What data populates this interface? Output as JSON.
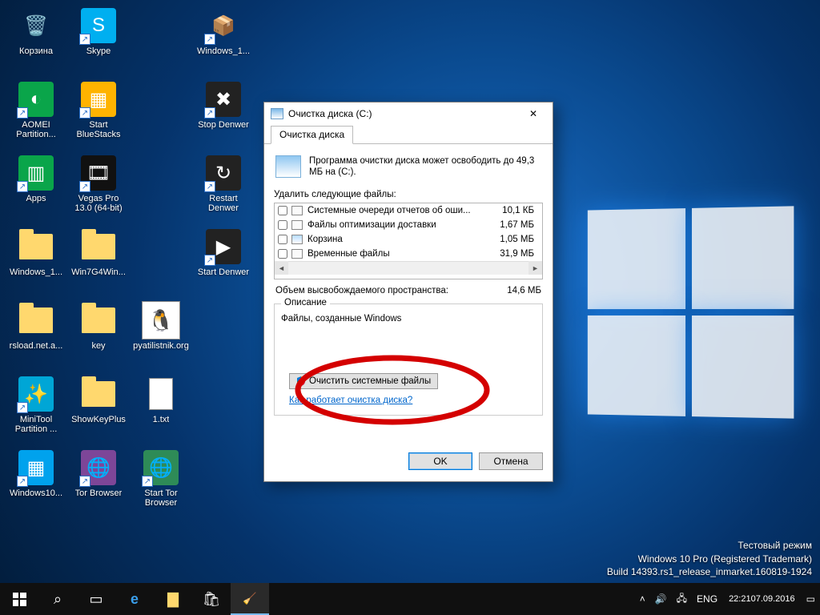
{
  "desktop": {
    "rows": [
      [
        {
          "name": "recycle-bin",
          "label": "Корзина",
          "glyph": "🗑️"
        },
        {
          "name": "skype",
          "label": "Skype",
          "glyph": "S",
          "bg": "#00aff0"
        },
        {
          "name": "spacer",
          "label": "",
          "glyph": ""
        },
        {
          "name": "winrar",
          "label": "Windows_1...",
          "glyph": "📦"
        }
      ],
      [
        {
          "name": "aomei",
          "label": "AOMEI Partition...",
          "glyph": "◐",
          "bg": "#0aa54a"
        },
        {
          "name": "bluestacks",
          "label": "Start BlueStacks",
          "glyph": "▦",
          "bg": "#ffb300"
        },
        {
          "name": "spacer",
          "label": "",
          "glyph": ""
        },
        {
          "name": "stop-denwer",
          "label": "Stop Denwer",
          "glyph": "✖",
          "bg": "#222"
        }
      ],
      [
        {
          "name": "apps",
          "label": "Apps",
          "glyph": "▥",
          "bg": "#0aa54a"
        },
        {
          "name": "vegas",
          "label": "Vegas Pro 13.0 (64-bit)",
          "glyph": "🎞",
          "bg": "#111"
        },
        {
          "name": "spacer",
          "label": "",
          "glyph": ""
        },
        {
          "name": "restart-denwer",
          "label": "Restart Denwer",
          "glyph": "↻",
          "bg": "#222"
        }
      ],
      [
        {
          "name": "folder-win1",
          "label": "Windows_1...",
          "glyph": "folder"
        },
        {
          "name": "folder-win7g4",
          "label": "Win7G4Win...",
          "glyph": "folder"
        },
        {
          "name": "spacer",
          "label": "",
          "glyph": ""
        },
        {
          "name": "start-denwer",
          "label": "Start Denwer",
          "glyph": "▶",
          "bg": "#222"
        }
      ],
      [
        {
          "name": "folder-rsload",
          "label": "rsload.net.a...",
          "glyph": "folder"
        },
        {
          "name": "folder-key",
          "label": "key",
          "glyph": "folder"
        },
        {
          "name": "img-pyatilistnik",
          "label": "pyatilistnik.org",
          "glyph": "img"
        }
      ],
      [
        {
          "name": "minitool",
          "label": "MiniTool Partition ...",
          "glyph": "✨",
          "bg": "#00a6d6"
        },
        {
          "name": "folder-showkey",
          "label": "ShowKeyPlus",
          "glyph": "folder"
        },
        {
          "name": "file-1txt",
          "label": "1.txt",
          "glyph": "file"
        }
      ],
      [
        {
          "name": "win10-app",
          "label": "Windows10...",
          "glyph": "▦",
          "bg": "#00a2ed"
        },
        {
          "name": "tor",
          "label": "Tor Browser",
          "glyph": "🌐",
          "bg": "#7d4698"
        },
        {
          "name": "start-tor",
          "label": "Start Tor Browser",
          "glyph": "🌐",
          "bg": "#2e8b57"
        }
      ]
    ]
  },
  "watermark": {
    "line1": "Тестовый режим",
    "line2": "Windows 10 Pro (Registered Trademark)",
    "line3": "Build 14393.rs1_release_inmarket.160819-1924"
  },
  "taskbar": {
    "lang": "ENG",
    "time": "22:21",
    "date": "07.09.2016"
  },
  "dialog": {
    "title": "Очистка диска  (C:)",
    "tab": "Очистка диска",
    "intro": "Программа очистки диска может освободить до 49,3 МБ на  (C:).",
    "list_label": "Удалить следующие файлы:",
    "items": [
      {
        "name": "Системные очереди отчетов об оши...",
        "size": "10,1 КБ"
      },
      {
        "name": "Файлы оптимизации доставки",
        "size": "1,67 МБ"
      },
      {
        "name": "Корзина",
        "size": "1,05 МБ",
        "bin": true
      },
      {
        "name": "Временные файлы",
        "size": "31,9 МБ"
      }
    ],
    "gain_label": "Объем высвобождаемого пространства:",
    "gain_value": "14,6 МБ",
    "group_title": "Описание",
    "group_text": "Файлы, созданные Windows",
    "sys_button": "Очистить системные файлы",
    "link": "Как работает очистка диска?",
    "ok": "OK",
    "cancel": "Отмена"
  }
}
